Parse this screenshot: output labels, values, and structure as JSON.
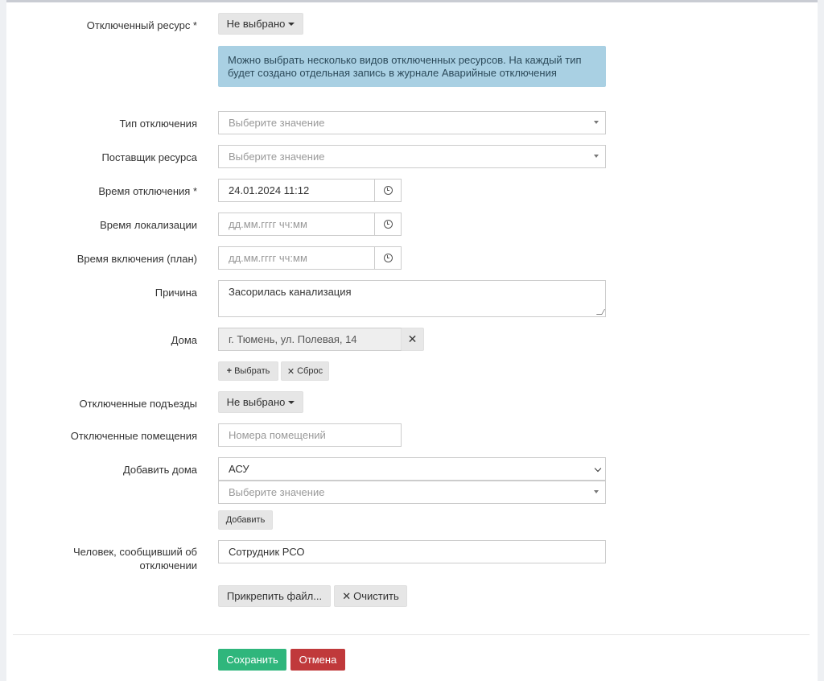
{
  "form": {
    "resource": {
      "label": "Отключенный ресурс *",
      "button": "Не выбрано"
    },
    "info": "Можно выбрать несколько видов отключенных ресурсов. На каждый тип будет создано отдельная запись в журнале Аварийные отключения",
    "type": {
      "label": "Тип отключения",
      "placeholder": "Выберите значение"
    },
    "supplier": {
      "label": "Поставщик ресурса",
      "placeholder": "Выберите значение"
    },
    "off_time": {
      "label": "Время отключения *",
      "value": "24.01.2024 11:12"
    },
    "loc_time": {
      "label": "Время локализации",
      "placeholder": "дд.мм.гггг чч:мм"
    },
    "on_time": {
      "label": "Время включения (план)",
      "placeholder": "дд.мм.гггг чч:мм"
    },
    "reason": {
      "label": "Причина",
      "value": "Засорилась канализация"
    },
    "houses": {
      "label": "Дома",
      "value": "г. Тюмень, ул. Полевая, 14",
      "select_btn": "Выбрать",
      "reset_btn": "Сброс"
    },
    "entrances": {
      "label": "Отключенные подъезды",
      "button": "Не выбрано"
    },
    "rooms": {
      "label": "Отключенные помещения",
      "placeholder": "Номера помещений"
    },
    "add_houses": {
      "label": "Добавить дома",
      "source": "АСУ",
      "placeholder": "Выберите значение",
      "add_btn": "Добавить"
    },
    "reporter": {
      "label": "Человек, сообщивший об отключении",
      "value": "Сотрудник РСО"
    },
    "attach_btn": "Прикрепить файл...",
    "clear_btn": "Очистить"
  },
  "footer": {
    "save": "Сохранить",
    "cancel": "Отмена"
  },
  "colors": {
    "save": "#2fb67c",
    "cancel": "#c0393b",
    "info_bg": "#a9d0e3"
  }
}
